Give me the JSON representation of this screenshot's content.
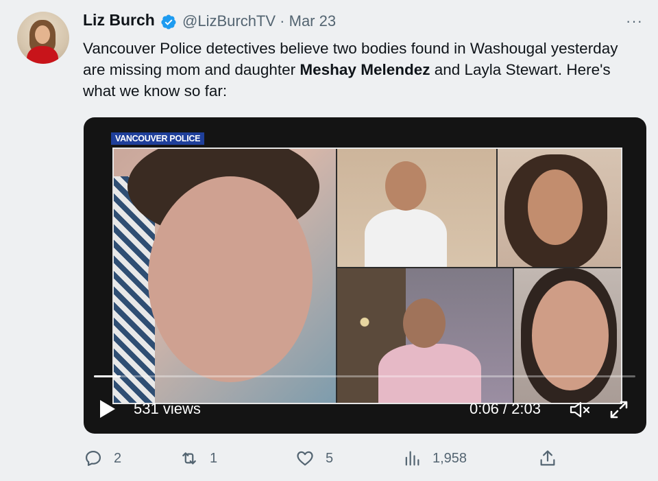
{
  "author": {
    "name": "Liz Burch",
    "handle": "@LizBurchTV",
    "separator": "·",
    "date": "Mar 23",
    "verified": true
  },
  "tweet": {
    "text_part1": "Vancouver Police detectives believe two bodies found in Washougal yesterday are missing mom and daughter ",
    "text_bold": "Meshay Melendez",
    "text_part2": " and Layla Stewart. Here's what we know so far:"
  },
  "media": {
    "banner": "VANCOUVER POLICE",
    "views": "531 views",
    "time": "0:06 / 2:03",
    "progress": 0.049,
    "muted": true
  },
  "actions": {
    "replies": "2",
    "retweets": "1",
    "likes": "5",
    "views": "1,958"
  },
  "more_label": "···",
  "colors": {
    "background": "#eef0f2",
    "text": "#0f1419",
    "muted": "#536471",
    "verified": "#1d9bf0",
    "video_bg": "#141414"
  }
}
